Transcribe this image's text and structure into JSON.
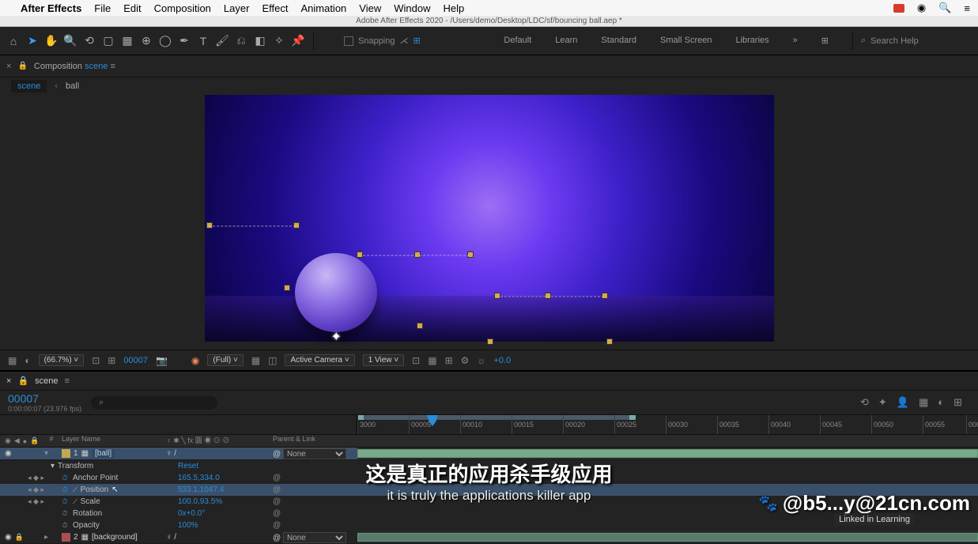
{
  "mac_menu": {
    "app": "After Effects",
    "items": [
      "File",
      "Edit",
      "Composition",
      "Layer",
      "Effect",
      "Animation",
      "View",
      "Window",
      "Help"
    ]
  },
  "doc_title": "Adobe After Effects 2020 - /Users/demo/Desktop/LDC/sf/bouncing ball.aep *",
  "toolbar": {
    "snapping": "Snapping",
    "workspaces": [
      "Default",
      "Learn",
      "Standard",
      "Small Screen",
      "Libraries"
    ],
    "search_placeholder": "Search Help"
  },
  "comp_tab": {
    "label": "Composition",
    "name": "scene"
  },
  "breadcrumb": [
    "scene",
    "ball"
  ],
  "viewer_footer": {
    "zoom": "(66.7%)",
    "frame": "00007",
    "resolution": "(Full)",
    "camera": "Active Camera",
    "views": "1 View",
    "exposure": "+0.0"
  },
  "timeline": {
    "comp_name": "scene",
    "timecode": "00007",
    "fps_line": "0:00:00:07 (23.976 fps)",
    "search_placeholder": "⌕",
    "ruler": [
      "3000",
      "00005",
      "00010",
      "00015",
      "00020",
      "00025",
      "00030",
      "00035",
      "00040",
      "00045",
      "00050",
      "00055",
      "0006"
    ],
    "cols": {
      "layer_name": "Layer Name",
      "switches": "♀ ✱ ╲ fx 圓 ◉ ⊙ ⊘",
      "parent": "Parent & Link"
    },
    "layers": [
      {
        "num": "1",
        "name": "[ball]",
        "tag": "yellow",
        "switches": "♀  /",
        "parent": "None",
        "selected": true
      },
      {
        "num": "2",
        "name": "[background]",
        "tag": "red",
        "switches": "♀  /",
        "parent": "None",
        "selected": false
      }
    ],
    "transform": {
      "label": "Transform",
      "reset": "Reset",
      "props": [
        {
          "name": "Anchor Point",
          "value": "165.5,334.0",
          "kf": true
        },
        {
          "name": "Position",
          "value": "533.1,1047.4",
          "kf": true,
          "selected": true
        },
        {
          "name": "Scale",
          "value": "100.0,93.5%",
          "kf": true
        },
        {
          "name": "Rotation",
          "value": "0x+0.0°",
          "kf": false
        },
        {
          "name": "Opacity",
          "value": "100%",
          "kf": false
        }
      ]
    }
  },
  "caption": {
    "cn": "这是真正的应用杀手级应用",
    "en": "it is truly the applications killer app"
  },
  "watermark": "@b5...y@21cn.com",
  "linkedin": "Linked in Learning"
}
